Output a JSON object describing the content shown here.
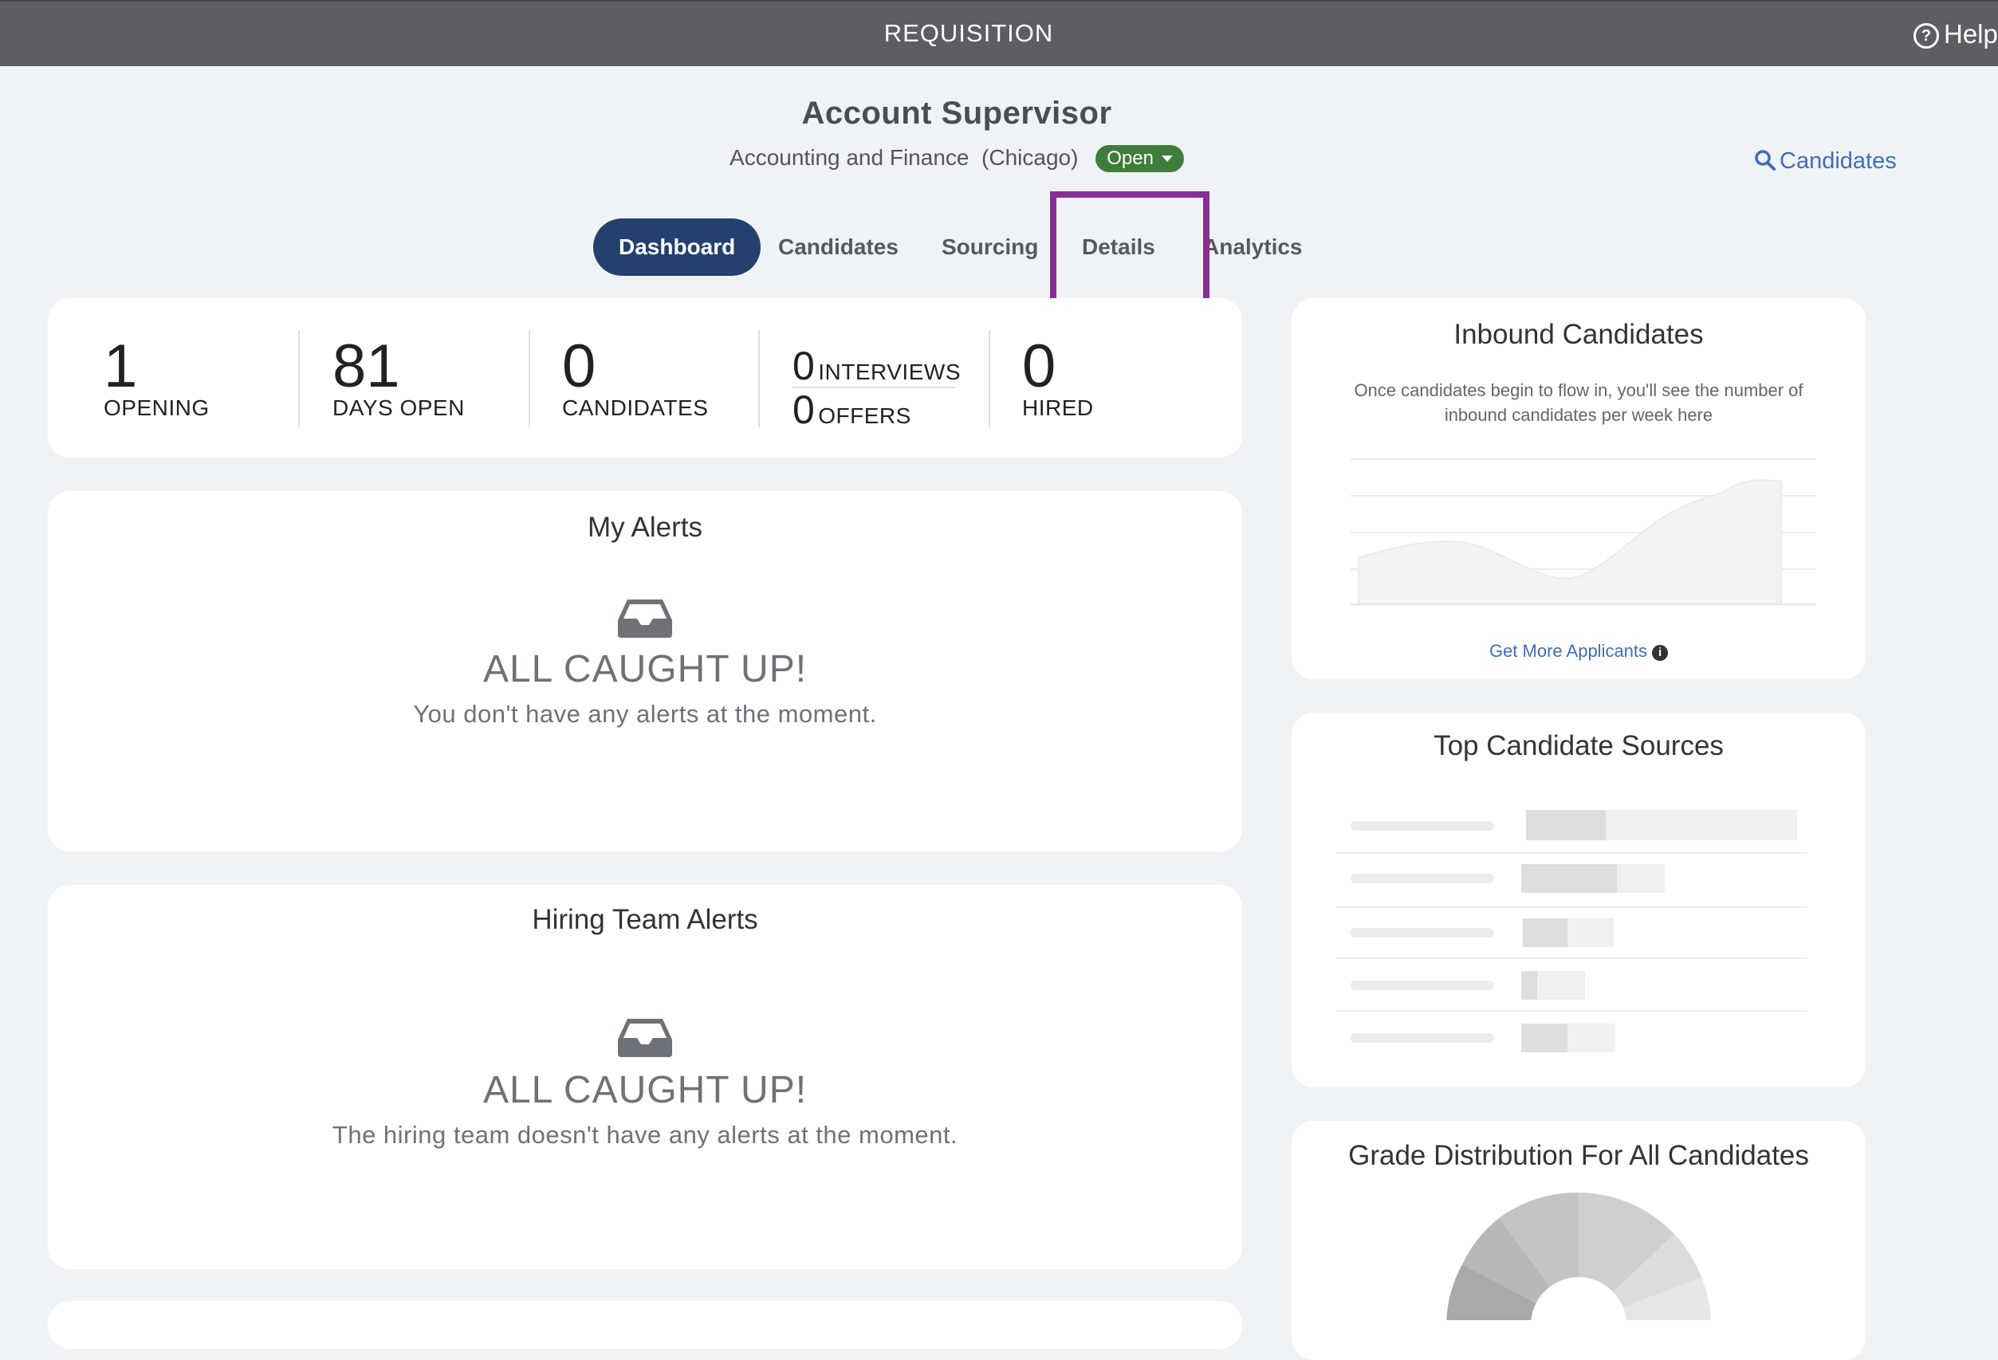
{
  "topbar": {
    "title": "REQUISITION",
    "help_label": "Help"
  },
  "job": {
    "title": "Account Supervisor",
    "department": "Accounting and Finance",
    "location": "(Chicago)",
    "status": "Open"
  },
  "search": {
    "label": "Candidates"
  },
  "tabs": [
    {
      "label": "Dashboard",
      "active": true
    },
    {
      "label": "Candidates",
      "active": false
    },
    {
      "label": "Sourcing",
      "active": false
    },
    {
      "label": "Details",
      "active": false
    },
    {
      "label": "Analytics",
      "active": false
    }
  ],
  "stats": {
    "openings": {
      "value": "1",
      "label": "OPENING"
    },
    "days_open": {
      "value": "81",
      "label": "DAYS OPEN"
    },
    "candidates": {
      "value": "0",
      "label": "CANDIDATES"
    },
    "interviews": {
      "value": "0",
      "label": "INTERVIEWS"
    },
    "offers": {
      "value": "0",
      "label": "OFFERS"
    },
    "hired": {
      "value": "0",
      "label": "HIRED"
    }
  },
  "my_alerts": {
    "title": "My Alerts",
    "headline": "ALL CAUGHT UP!",
    "message": "You don't have any alerts at the moment."
  },
  "team_alerts": {
    "title": "Hiring Team Alerts",
    "headline": "ALL CAUGHT UP!",
    "message": "The hiring team doesn't have any alerts at the moment."
  },
  "inbound": {
    "title": "Inbound Candidates",
    "description": "Once candidates begin to flow in, you'll see the number of inbound candidates per week here",
    "link": "Get More Applicants"
  },
  "sources": {
    "title": "Top Candidate Sources"
  },
  "grade": {
    "title": "Grade Distribution For All Candidates"
  },
  "colors": {
    "accent": "#24406f",
    "status_green": "#3e7d3a",
    "link": "#3f6fb6",
    "highlight": "#8a2e95"
  }
}
